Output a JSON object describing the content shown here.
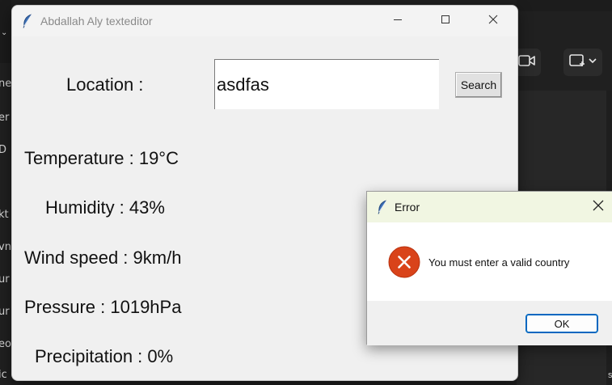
{
  "main_window": {
    "title": "Abdallah Aly texteditor",
    "location_label": "Location :",
    "location_value": "asdfas",
    "search_button": "Search",
    "temperature": "Temperature : 19°C",
    "humidity": "Humidity : 43%",
    "wind_speed": "Wind speed : 9km/h",
    "pressure": "Pressure : 1019hPa",
    "precipitation": "Precipitation : 0%"
  },
  "error_dialog": {
    "title": "Error",
    "message": "You must enter a valid country",
    "ok_button": "OK"
  },
  "background": {
    "left_fragments": [
      "ne",
      "er",
      "D",
      "kt",
      "vn",
      "ur",
      "ur",
      "eo",
      "ic"
    ],
    "right_fragment": "s"
  },
  "icons": {
    "title_icon": "feather-icon",
    "error_icon": "error-x-icon",
    "video_icon": "video-camera-icon",
    "share_icon": "screen-share-icon"
  },
  "colors": {
    "error_red": "#d83b01",
    "ok_border": "#0067c0"
  }
}
